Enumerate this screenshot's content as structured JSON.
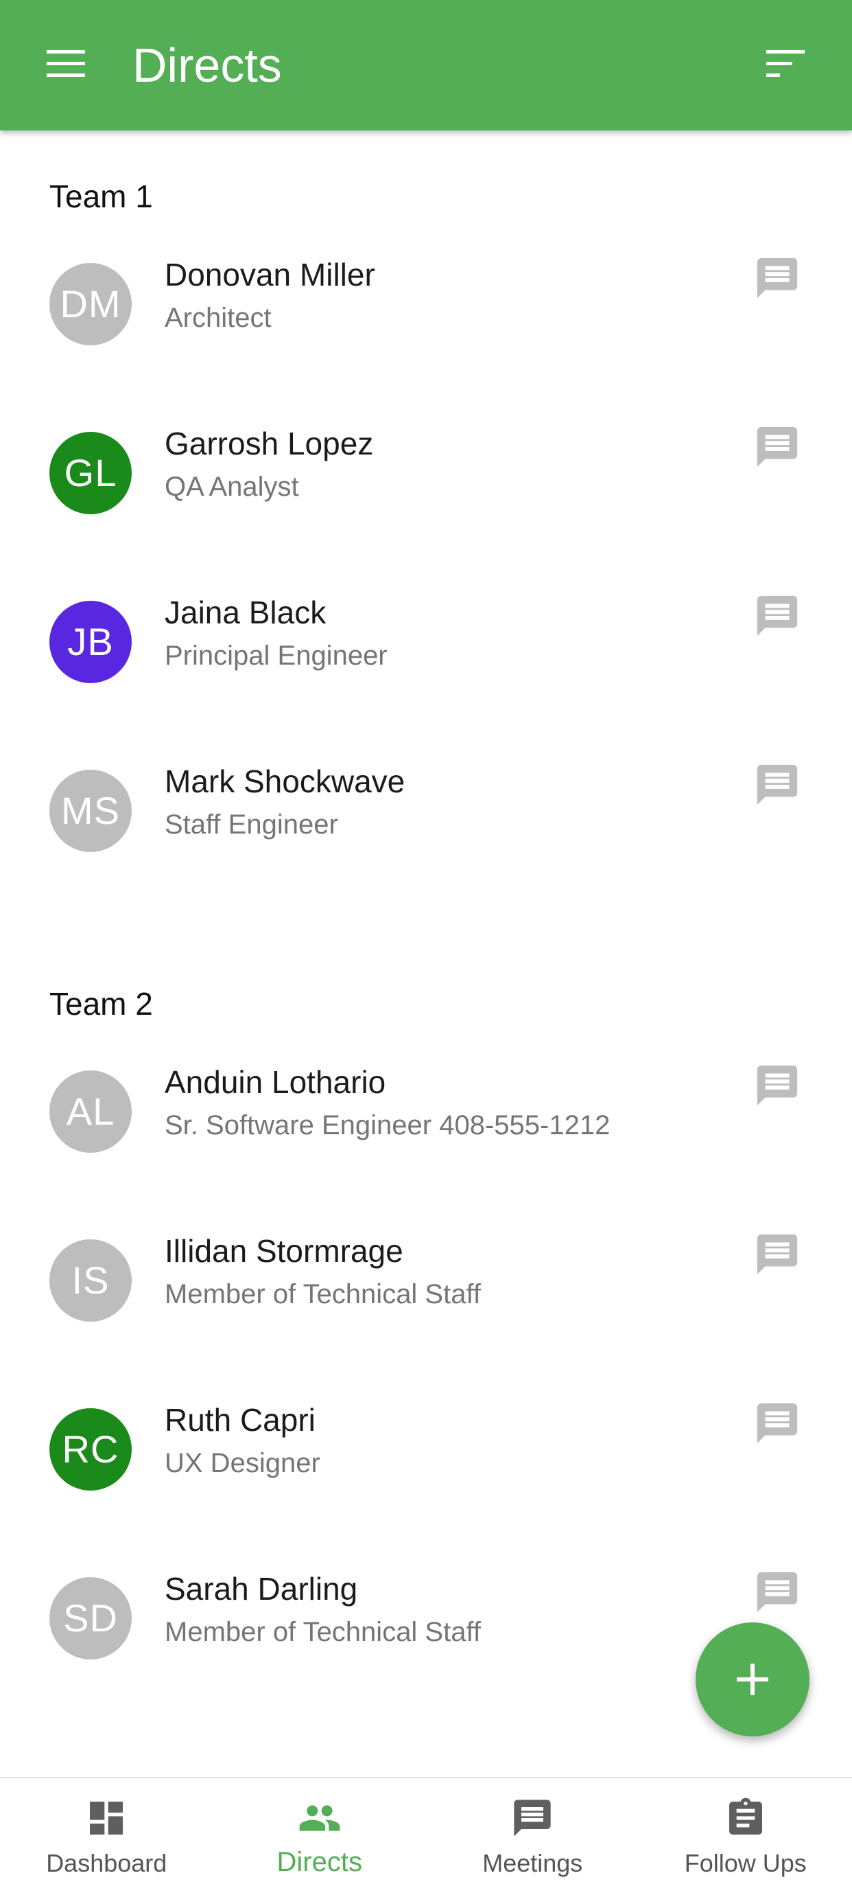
{
  "appbar": {
    "title": "Directs",
    "menu_icon": "menu-icon",
    "sort_icon": "sort-icon"
  },
  "colors": {
    "primary": "#53ae56",
    "avatar_gray": "#bdbdbd",
    "avatar_green": "#1a8a1a",
    "avatar_purple": "#5a27e0"
  },
  "sections": [
    {
      "header": "Team 1",
      "people": [
        {
          "initials": "DM",
          "name": "Donovan Miller",
          "role": "Architect",
          "avatar_color": "#bdbdbd"
        },
        {
          "initials": "GL",
          "name": "Garrosh Lopez",
          "role": "QA Analyst",
          "avatar_color": "#1a8a1a"
        },
        {
          "initials": "JB",
          "name": "Jaina Black",
          "role": "Principal Engineer",
          "avatar_color": "#5a27e0"
        },
        {
          "initials": "MS",
          "name": "Mark Shockwave",
          "role": "Staff Engineer",
          "avatar_color": "#bdbdbd"
        }
      ]
    },
    {
      "header": "Team 2",
      "people": [
        {
          "initials": "AL",
          "name": "Anduin Lothario",
          "role": "Sr. Software Engineer 408-555-1212",
          "avatar_color": "#bdbdbd"
        },
        {
          "initials": "IS",
          "name": "Illidan Stormrage",
          "role": "Member of Technical Staff",
          "avatar_color": "#bdbdbd"
        },
        {
          "initials": "RC",
          "name": "Ruth Capri",
          "role": "UX Designer",
          "avatar_color": "#1a8a1a"
        },
        {
          "initials": "SD",
          "name": "Sarah Darling",
          "role": "Member of Technical Staff",
          "avatar_color": "#bdbdbd"
        }
      ]
    }
  ],
  "fab": {
    "icon": "plus-icon"
  },
  "bottom_nav": [
    {
      "label": "Dashboard",
      "icon": "dashboard-icon",
      "active": false
    },
    {
      "label": "Directs",
      "icon": "people-icon",
      "active": true
    },
    {
      "label": "Meetings",
      "icon": "chat-icon",
      "active": false
    },
    {
      "label": "Follow Ups",
      "icon": "clipboard-icon",
      "active": false
    }
  ]
}
